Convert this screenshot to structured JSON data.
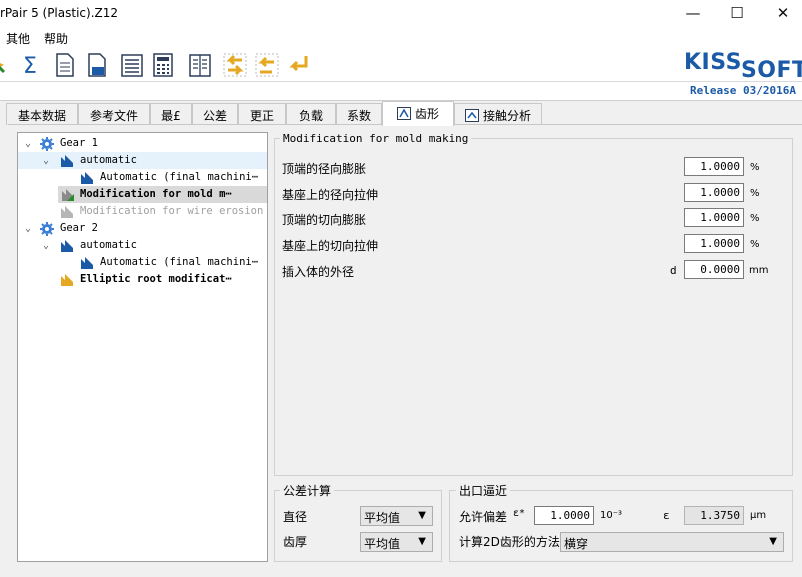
{
  "window": {
    "title": "rPair 5 (Plastic).Z12",
    "minimize": "—",
    "maximize": "☐",
    "close": "✕"
  },
  "menu": [
    {
      "label": "其他"
    },
    {
      "label": "帮助"
    }
  ],
  "toolbar_icons": [
    "calc-arrow-icon",
    "sum-icon",
    "document-icon",
    "save-icon",
    "list-report-icon",
    "calculator-icon",
    "book-icon",
    "gear-exchange-icon",
    "gear-exchange-2-icon",
    "arrow-return-icon"
  ],
  "logo": {
    "kiss": "KISS",
    "soft": "SOFT"
  },
  "release": "Release 03/2016A",
  "tabs": [
    {
      "label": "基本数据"
    },
    {
      "label": "参考文件"
    },
    {
      "label": "最£"
    },
    {
      "label": "公差"
    },
    {
      "label": "更正"
    },
    {
      "label": "负载"
    },
    {
      "label": "系数"
    },
    {
      "label": "齿形"
    },
    {
      "label": "接触分析"
    }
  ],
  "tree": [
    {
      "label": "Gear 1",
      "expander": "⌄"
    },
    {
      "label": "automatic",
      "expander": "⌄"
    },
    {
      "label": "Automatic (final machini⋯"
    },
    {
      "label": "Modification for mold m⋯"
    },
    {
      "label": "Modification for wire erosion"
    },
    {
      "label": "Gear 2",
      "expander": "⌄"
    },
    {
      "label": "automatic",
      "expander": "⌄"
    },
    {
      "label": "Automatic (final machini⋯"
    },
    {
      "label": "Elliptic root modificat⋯"
    }
  ],
  "mold": {
    "title": "Modification for mold making",
    "rows": [
      {
        "label": "顶端的径向膨胀",
        "value": "1.0000",
        "unit": "%"
      },
      {
        "label": "基座上的径向拉伸",
        "value": "1.0000",
        "unit": "%"
      },
      {
        "label": "顶端的切向膨胀",
        "value": "1.0000",
        "unit": "%"
      },
      {
        "label": "基座上的切向拉伸",
        "value": "1.0000",
        "unit": "%"
      },
      {
        "label": "插入体的外径",
        "symbol": "d",
        "value": "0.0000",
        "unit": "mm"
      }
    ]
  },
  "tolerance": {
    "title": "公差计算",
    "rows": [
      {
        "label": "直径",
        "value": "平均值",
        "caret": "▼"
      },
      {
        "label": "齿厚",
        "value": "平均值",
        "caret": "▼"
      }
    ]
  },
  "exit": {
    "title": "出口逼近",
    "deviation_label": "允许偏差",
    "deviation_symbol": "ε*",
    "deviation_value": "1.0000",
    "deviation_unit": "10⁻³",
    "eps_symbol": "ε",
    "eps_value": "1.3750",
    "eps_unit": "μm",
    "method_label": "计算2D齿形的方法",
    "method_value": "横穿",
    "method_caret": "▼"
  }
}
